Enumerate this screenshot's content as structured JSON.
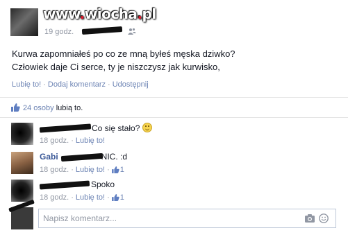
{
  "watermark": {
    "part1": "www",
    "dot": ".",
    "part2": "wiocha",
    "dot2": ".",
    "part3": "pl"
  },
  "post": {
    "time": "19 godz.",
    "text_line1": "Kurwa zapomniałeś po co ze mną byłeś męska dziwko?",
    "text_line2": "Człowiek daje Ci serce, ty je niszczysz jak kurwisko,",
    "actions": {
      "like": "Lubię to!",
      "comment": "Dodaj komentarz",
      "share": "Udostępnij",
      "separator": "·"
    }
  },
  "likes": {
    "count_text": "24 osoby",
    "suffix": "lubią to."
  },
  "comments": [
    {
      "text": "Co się stało?",
      "time": "18 godz.",
      "like": "Lubię to!",
      "count": ""
    },
    {
      "name": "Gabi",
      "text": "NIC. :d",
      "time": "18 godz.",
      "like": "Lubię to!",
      "count": "1"
    },
    {
      "text": "Spoko",
      "time": "18 godz.",
      "like": "Lubię to!",
      "count": "1"
    }
  ],
  "reply": {
    "placeholder": "Napisz komentarz..."
  },
  "colors": {
    "link": "#6d84b4",
    "name": "#3b5998",
    "meta": "#9197a3"
  }
}
